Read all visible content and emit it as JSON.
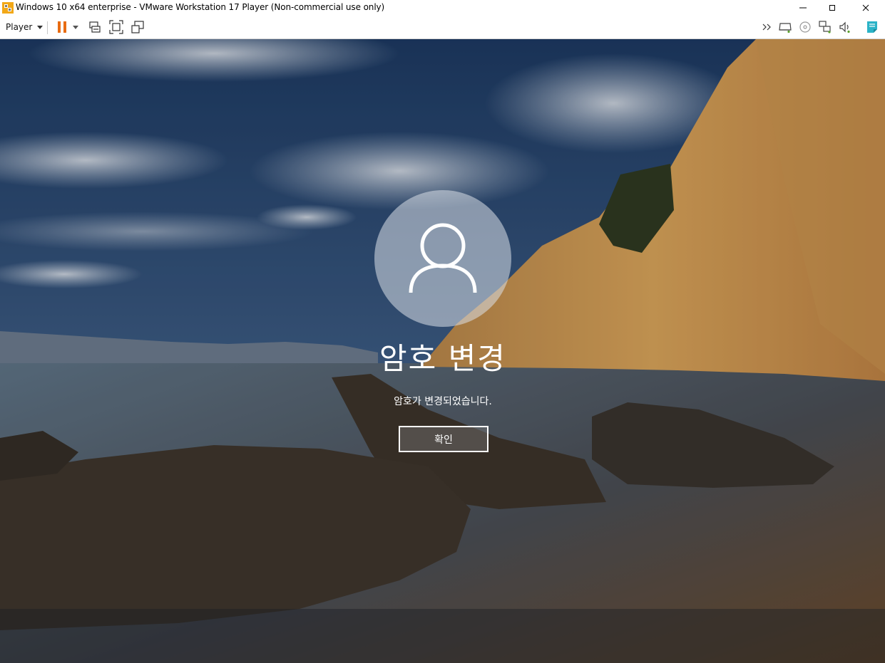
{
  "window": {
    "title": "Windows 10 x64 enterprise - VMware Workstation 17 Player (Non-commercial use only)",
    "icon": "vmware-player-icon",
    "controls": [
      "minimize-icon",
      "maximize-icon",
      "close-icon"
    ]
  },
  "toolbar": {
    "player_menu_label": "Player",
    "left_icons": [
      "pause-icon",
      "dropdown-icon",
      "send-ctrl-alt-del-icon",
      "full-screen-icon",
      "unity-icon"
    ],
    "right_icons": [
      "chevron-right-double-icon",
      "hard-disk-icon",
      "cd-dvd-icon",
      "network-adapter-icon",
      "sound-icon",
      "message-log-icon"
    ],
    "accent_color": "#e86c12"
  },
  "lock_screen": {
    "avatar_icon": "user-icon",
    "heading": "암호 변경",
    "message": "암호가 변경되었습니다.",
    "ok_button_label": "확인"
  }
}
